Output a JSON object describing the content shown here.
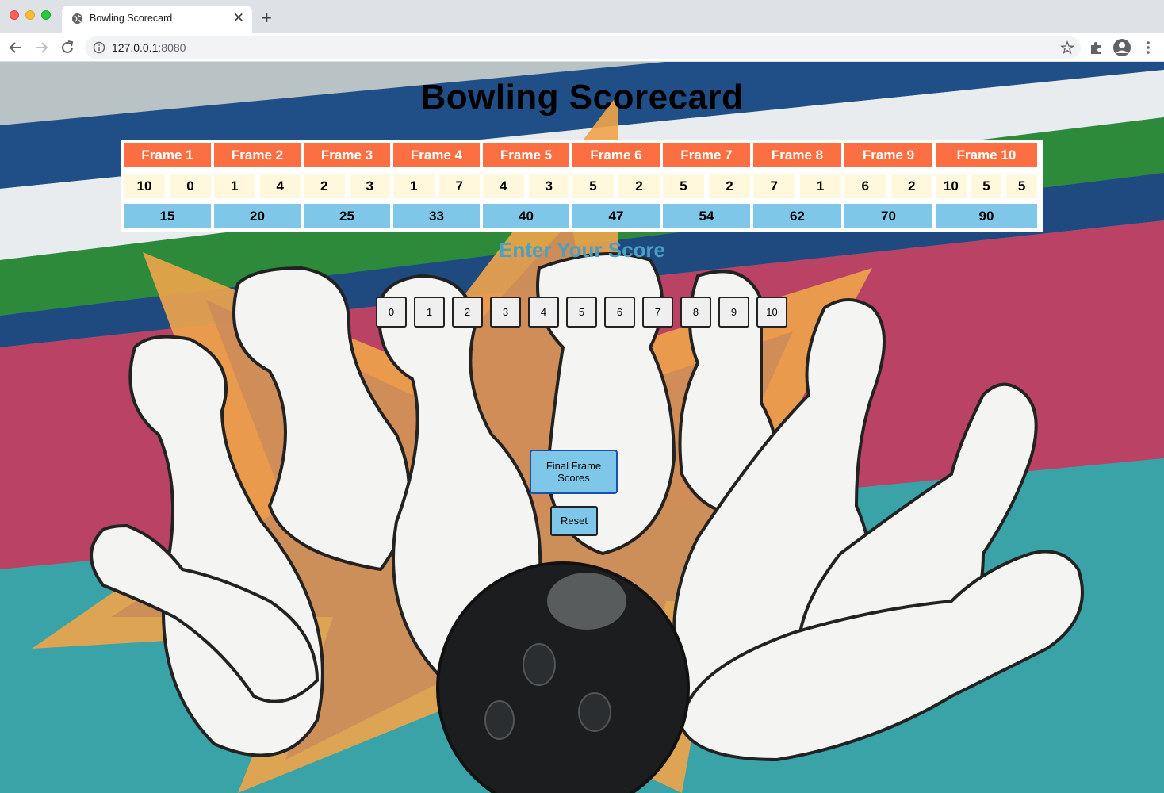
{
  "browser": {
    "tab_title": "Bowling Scorecard",
    "new_tab": "+",
    "close": "✕",
    "url_host": "127.0.0.1",
    "url_port": ":8080"
  },
  "page": {
    "title": "Bowling Scorecard",
    "enter_label": "Enter Your Score",
    "final_button": "Final Frame Scores",
    "reset_button": "Reset",
    "pin_buttons": [
      "0",
      "1",
      "2",
      "3",
      "4",
      "5",
      "6",
      "7",
      "8",
      "9",
      "10"
    ]
  },
  "scorecard": {
    "frames": [
      {
        "label": "Frame 1",
        "rolls": [
          "10",
          "0"
        ],
        "total": "15"
      },
      {
        "label": "Frame 2",
        "rolls": [
          "1",
          "4"
        ],
        "total": "20"
      },
      {
        "label": "Frame 3",
        "rolls": [
          "2",
          "3"
        ],
        "total": "25"
      },
      {
        "label": "Frame 4",
        "rolls": [
          "1",
          "7"
        ],
        "total": "33"
      },
      {
        "label": "Frame 5",
        "rolls": [
          "4",
          "3"
        ],
        "total": "40"
      },
      {
        "label": "Frame 6",
        "rolls": [
          "5",
          "2"
        ],
        "total": "47"
      },
      {
        "label": "Frame 7",
        "rolls": [
          "5",
          "2"
        ],
        "total": "54"
      },
      {
        "label": "Frame 8",
        "rolls": [
          "7",
          "1"
        ],
        "total": "62"
      },
      {
        "label": "Frame 9",
        "rolls": [
          "6",
          "2"
        ],
        "total": "70"
      },
      {
        "label": "Frame 10",
        "rolls": [
          "10",
          "5",
          "5"
        ],
        "total": "90"
      }
    ]
  },
  "colors": {
    "frame_header": "#fb6f43",
    "roll_cell": "#fff8dc",
    "total_cell": "#7fc7e8",
    "enter_label": "#4a9fc4"
  }
}
